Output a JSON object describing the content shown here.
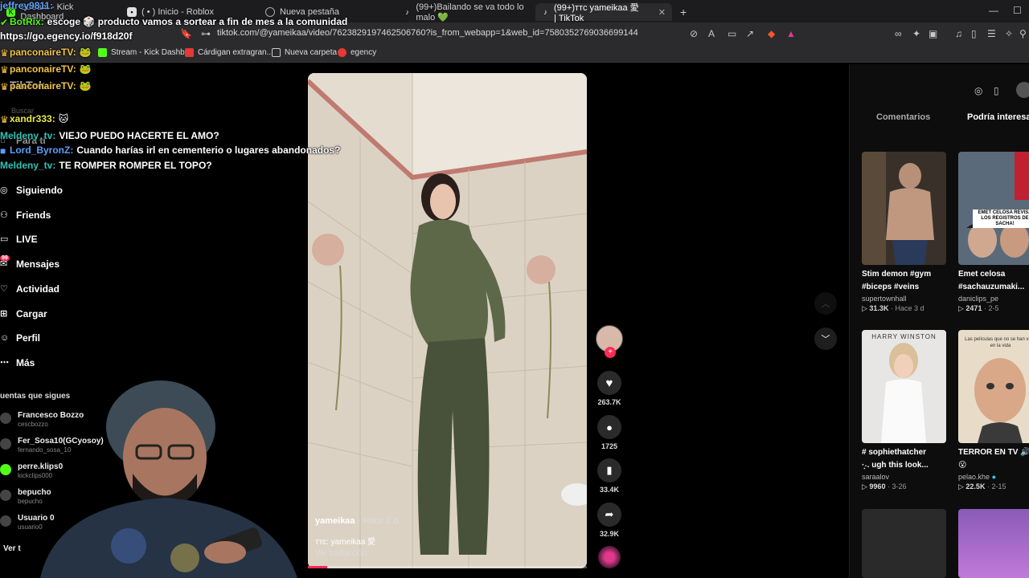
{
  "browser": {
    "tabs": [
      {
        "label": "Stream - Kick Dashboard",
        "active": false
      },
      {
        "label": "( • ) Inicio - Roblox",
        "active": false
      },
      {
        "label": "Nueva pestaña",
        "active": false
      },
      {
        "label": "(99+)Bailando se va todo lo malo 💚",
        "active": false
      },
      {
        "label": "(99+)ттс yameikaa 愛 | TikTok",
        "active": true
      }
    ],
    "url": "tiktok.com/@yameikaa/video/7623829197462506760?is_from_webapp=1&web_id=7580352769036699144",
    "bookmarks": [
      "Stream - Kick Dashb...",
      "Cárdigan extragran...",
      "Nueva carpeta",
      "egency"
    ]
  },
  "chat": [
    {
      "user": "jeffrey9811:",
      "text": "",
      "color": "#5aa0ff"
    },
    {
      "user": "BotRix:",
      "text": "escoge 🎲 producto vamos a sortear a fin de mes a la comunidad",
      "color": "#53fc18"
    },
    {
      "user": "",
      "text": "https://go.egency.io/f918d20f",
      "color": "#ffffff"
    },
    {
      "user": "panconaireTV:",
      "text": "🐸",
      "color": "#f4c542"
    },
    {
      "user": "panconaireTV:",
      "text": "🐸",
      "color": "#f4c542"
    },
    {
      "user": "panconaireTV:",
      "text": "🐸",
      "color": "#f4c542"
    },
    {
      "user": "xandr333:",
      "text": "🐱",
      "color": "#e8e84a"
    },
    {
      "user": "Meldeny_tv:",
      "text": "VIEJO PUEDO HACERTE EL AMO?",
      "color": "#2ec4b6"
    },
    {
      "user": "Lord_ByronZ:",
      "text": "Cuando harías irl en cementerio o lugares abandonados?",
      "color": "#5aa0ff"
    },
    {
      "user": "Meldeny_tv:",
      "text": "TE ROMPER ROMPER EL TOPO?",
      "color": "#2ec4b6"
    }
  ],
  "tiktok": {
    "logo": "TikTok",
    "search_placeholder": "Buscar",
    "nav": [
      {
        "label": "Para ti",
        "icon": "home-icon"
      },
      {
        "label": "Siguiendo",
        "icon": "following-icon"
      },
      {
        "label": "Friends",
        "icon": "friends-icon"
      },
      {
        "label": "LIVE",
        "icon": "live-icon"
      },
      {
        "label": "Mensajes",
        "icon": "messages-icon",
        "badge": "99"
      },
      {
        "label": "Actividad",
        "icon": "activity-icon"
      },
      {
        "label": "Cargar",
        "icon": "upload-icon"
      },
      {
        "label": "Perfil",
        "icon": "profile-icon"
      },
      {
        "label": "Más",
        "icon": "more-icon"
      }
    ],
    "following_title": "uentas que sigues",
    "following": [
      {
        "name": "Francesco Bozzo",
        "handle": "cescbozzo"
      },
      {
        "name": "Fer_Sosa10(GCyosoy)",
        "handle": "fernando_sosa_10"
      },
      {
        "name": "perre.klips0",
        "handle": "kickclips000"
      },
      {
        "name": "bepucho",
        "handle": "bepucho"
      },
      {
        "name": "Usuario 0",
        "handle": "usuario0"
      }
    ],
    "see_more": "Ver t",
    "video": {
      "author": "yameikaa",
      "time": "· Hace 2 d",
      "desc": "ттс: yameikaa 愛",
      "translate": "Ver traducción",
      "progress": 0.07
    },
    "actions": {
      "likes": "263.7K",
      "comments": "1725",
      "saves": "33.4K",
      "shares": "32.9K"
    },
    "right_tabs": [
      "Comentarios",
      "Podría interesarte"
    ],
    "cards": [
      {
        "title": "Stim demon #gym",
        "title2": "#biceps #veins",
        "author": "supertownhall",
        "views": "31.3K",
        "date": "· Hace 3 d"
      },
      {
        "title": "Emet celosa",
        "title2": "#sachauzumaki...",
        "author": "daniclips_pe",
        "views": "2471",
        "date": "· 2-5"
      },
      {
        "title": "# sophiethatcher",
        "title2": "·͙˖. ugh this look...",
        "author": "saraalov",
        "views": "9960",
        "date": "· 3-26"
      },
      {
        "title": "TERROR EN TV 🔊",
        "title2": "😮",
        "author": "pelao.khe",
        "views": "22.5K",
        "date": "· 2-15"
      }
    ],
    "thumb_texts": {
      "emet": "EMET CELOSA REVISA LOS REGISTROS DE SACHA!",
      "harry": "HARRY WINSTON",
      "terror": "Las películas que no se han visto en la vida"
    }
  }
}
